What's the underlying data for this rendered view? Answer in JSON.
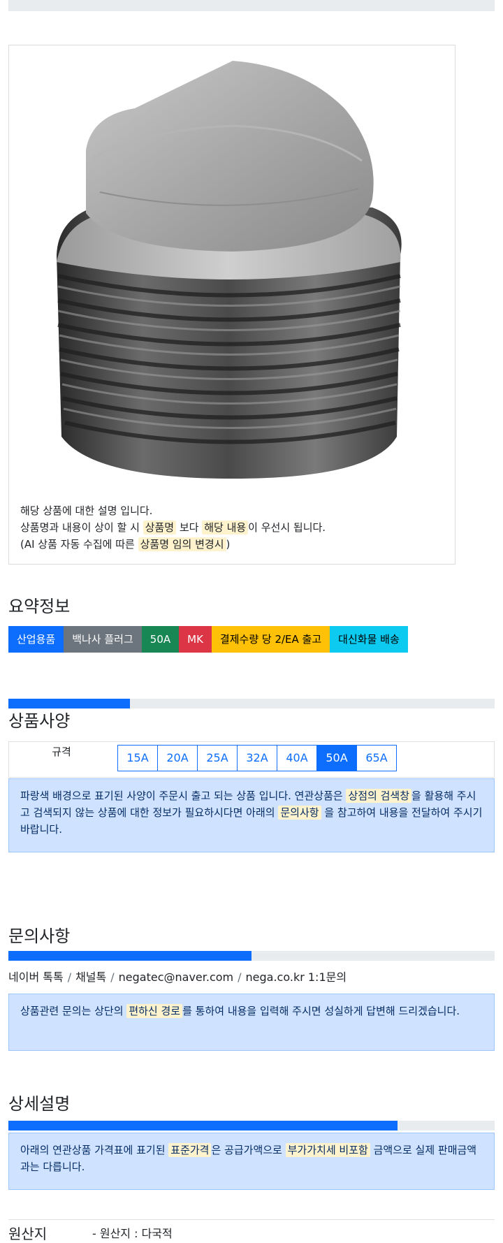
{
  "product": {
    "image_alt": "galvanized-pipe-plug",
    "description_line1": "해당 상품에 대한 설명 입니다.",
    "description_line2": {
      "p1": "상품명과 내용이 상이 할 시 ",
      "hl1": "상품명",
      "p2": " 보다 ",
      "hl2": "해당 내용",
      "p3": "이 우선시 됩니다."
    },
    "description_line3": {
      "p1": "(AI 상품 자동 수집에 따른 ",
      "hl1": "상품명 임의 변경시",
      "p2": ")"
    }
  },
  "summary": {
    "title": "요약정보",
    "badges": [
      {
        "label": "산업용품",
        "color": "#0d6efd",
        "text_color": "#ffffff"
      },
      {
        "label": "백나사 플러그",
        "color": "#6c757d",
        "text_color": "#ffffff"
      },
      {
        "label": "50A",
        "color": "#198754",
        "text_color": "#ffffff"
      },
      {
        "label": "MK",
        "color": "#dc3545",
        "text_color": "#ffffff"
      },
      {
        "label": "결제수량 당 2/EA 출고",
        "color": "#ffc107",
        "text_color": "#000000"
      },
      {
        "label": "대신화물 배송",
        "color": "#0dcaf0",
        "text_color": "#000000"
      }
    ]
  },
  "spec": {
    "progress": 0.25,
    "title": "상품사양",
    "label": "규격",
    "options": [
      "15A",
      "20A",
      "25A",
      "32A",
      "40A",
      "50A",
      "65A"
    ],
    "selected": "50A",
    "notice": {
      "p1": "파랑색 배경으로 표기된 사양이 주문시 출고 되는 상품 입니다. 연관상품은 ",
      "hl1": "상점의 검색창",
      "p2": "을 활용해 주시고 검색되지 않는 상품에 대한 정보가 필요하시다면 아래의 ",
      "hl2": "문의사항",
      "p3": " 을 참고하여 내용을 전달하여 주시기 바랍니다."
    }
  },
  "inquiry": {
    "title": "문의사항",
    "progress": 0.5,
    "contacts": [
      "네이버 톡톡",
      "채널톡",
      "negatec@naver.com",
      "nega.co.kr 1:1문의"
    ],
    "separator": "/",
    "notice": {
      "p1": "상품관련 문의는 상단의 ",
      "hl1": "편하신 경로",
      "p2": "를 통하여 내용을 입력해 주시면 성실하게 답변해 드리겠습니다."
    }
  },
  "detail": {
    "title": "상세설명",
    "progress": 0.8,
    "notice": {
      "p1": "아래의 연관상품 가격표에 표기된 ",
      "hl1": "표준가격",
      "p2": "은 공급가액으로 ",
      "hl2": "부가가치세 비포함",
      "p3": " 금액으로 실제 판매금액과는 다릅니다."
    }
  },
  "origin": {
    "label": "원산지",
    "value": "- 원산지 : 다국적"
  },
  "colors": {
    "primary": "#0d6efd",
    "alert_bg": "#cfe2ff",
    "highlight": "#fff3cd"
  }
}
